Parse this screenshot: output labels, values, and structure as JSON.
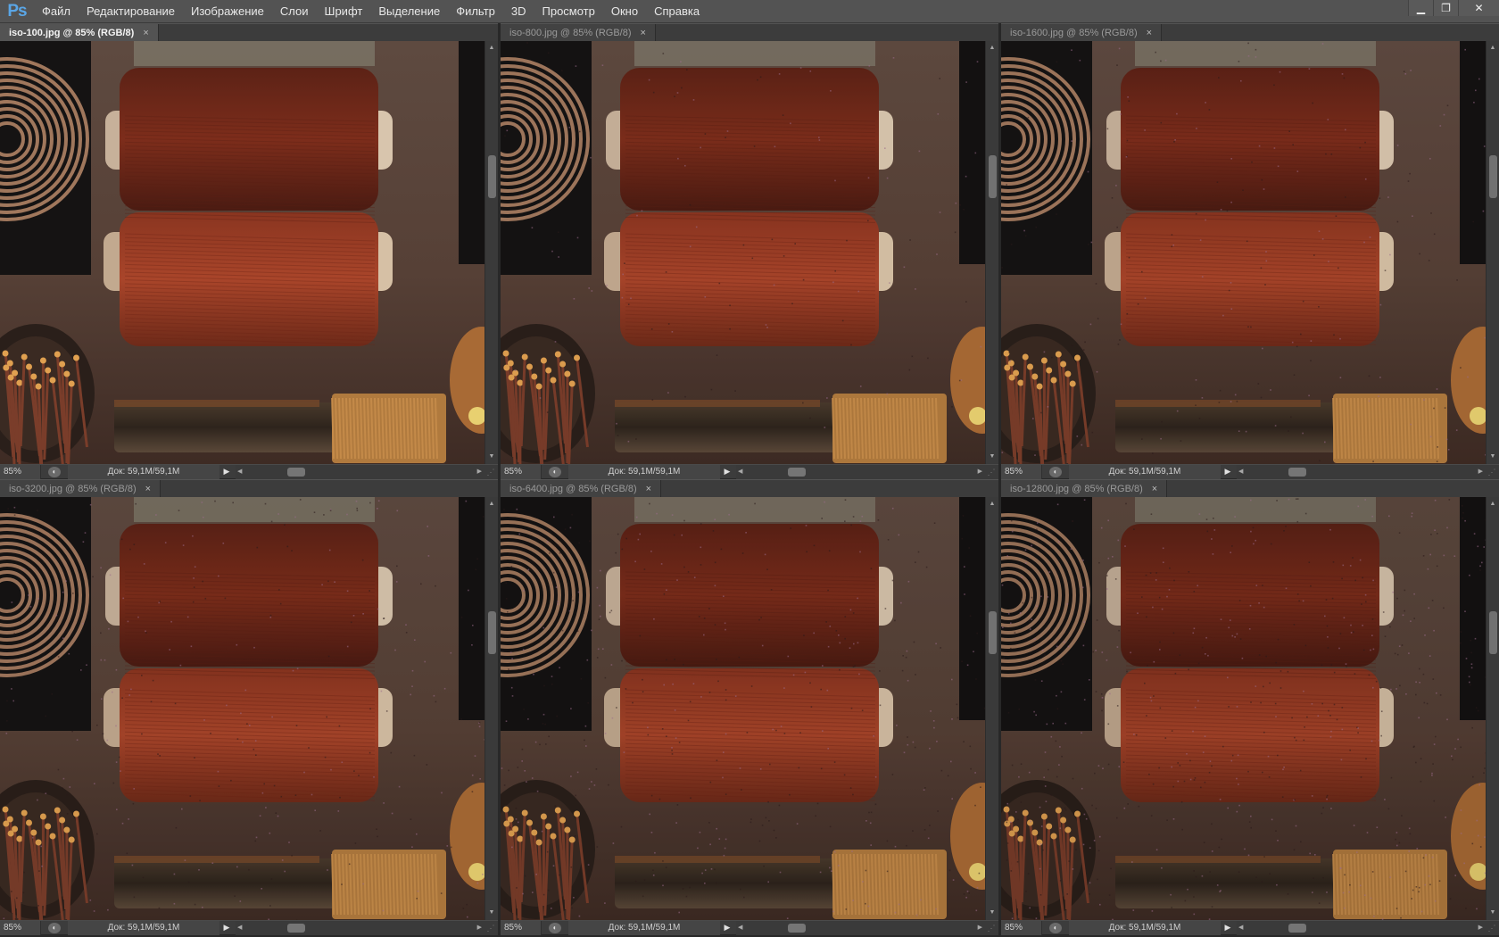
{
  "app": {
    "logo": "Ps"
  },
  "menu": [
    "Файл",
    "Редактирование",
    "Изображение",
    "Слои",
    "Шрифт",
    "Выделение",
    "Фильтр",
    "3D",
    "Просмотр",
    "Окно",
    "Справка"
  ],
  "window_controls": {
    "minimize": "▁",
    "restore": "❐",
    "close": "✕"
  },
  "documents": [
    {
      "tab": "iso-100.jpg @ 85% (RGB/8)",
      "close": "×",
      "zoom": "85%",
      "doc": "Док: 59,1M/59,1M",
      "active": true,
      "noise": 0.0
    },
    {
      "tab": "iso-800.jpg @ 85% (RGB/8)",
      "close": "×",
      "zoom": "85%",
      "doc": "Док: 59,1M/59,1M",
      "active": false,
      "noise": 0.15
    },
    {
      "tab": "iso-1600.jpg @ 85% (RGB/8)",
      "close": "×",
      "zoom": "85%",
      "doc": "Док: 59,1M/59,1M",
      "active": false,
      "noise": 0.25
    },
    {
      "tab": "iso-3200.jpg @ 85% (RGB/8)",
      "close": "×",
      "zoom": "85%",
      "doc": "Док: 59,1M/59,1M",
      "active": false,
      "noise": 0.35
    },
    {
      "tab": "iso-6400.jpg @ 85% (RGB/8)",
      "close": "×",
      "zoom": "85%",
      "doc": "Док: 59,1M/59,1M",
      "active": false,
      "noise": 0.5
    },
    {
      "tab": "iso-12800.jpg @ 85% (RGB/8)",
      "close": "×",
      "zoom": "85%",
      "doc": "Док: 59,1M/59,1M",
      "active": false,
      "noise": 0.7
    }
  ],
  "icons": {
    "tab_close": "close-icon",
    "status": "status-icon",
    "status_menu": "triangle-right-icon"
  }
}
